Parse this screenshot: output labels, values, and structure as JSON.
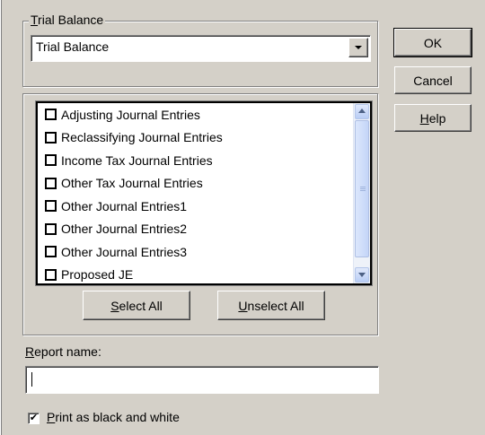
{
  "report_group": {
    "label_prefix": "",
    "label_mnemonic": "T",
    "label_rest": "rial Balance",
    "selected": "Trial Balance"
  },
  "buttons": {
    "ok": "OK",
    "cancel": "Cancel",
    "help_mnemonic": "H",
    "help_rest": "elp",
    "select_all_mnemonic": "S",
    "select_all_rest": "elect All",
    "unselect_all_mnemonic": "U",
    "unselect_all_rest": "nselect All"
  },
  "journal_entries": [
    {
      "label": "Adjusting Journal Entries",
      "checked": false
    },
    {
      "label": "Reclassifying Journal Entries",
      "checked": false
    },
    {
      "label": "Income Tax Journal Entries",
      "checked": false
    },
    {
      "label": "Other Tax Journal Entries",
      "checked": false
    },
    {
      "label": "Other Journal Entries1",
      "checked": false
    },
    {
      "label": "Other Journal Entries2",
      "checked": false
    },
    {
      "label": "Other Journal Entries3",
      "checked": false
    },
    {
      "label": "Proposed JE",
      "checked": false
    }
  ],
  "report_name": {
    "label_mnemonic": "R",
    "label_rest": "eport name:",
    "value": ""
  },
  "print_bw": {
    "label_mnemonic": "P",
    "label_rest": "rint as black and white",
    "checked": true,
    "check_glyph": "✔"
  }
}
